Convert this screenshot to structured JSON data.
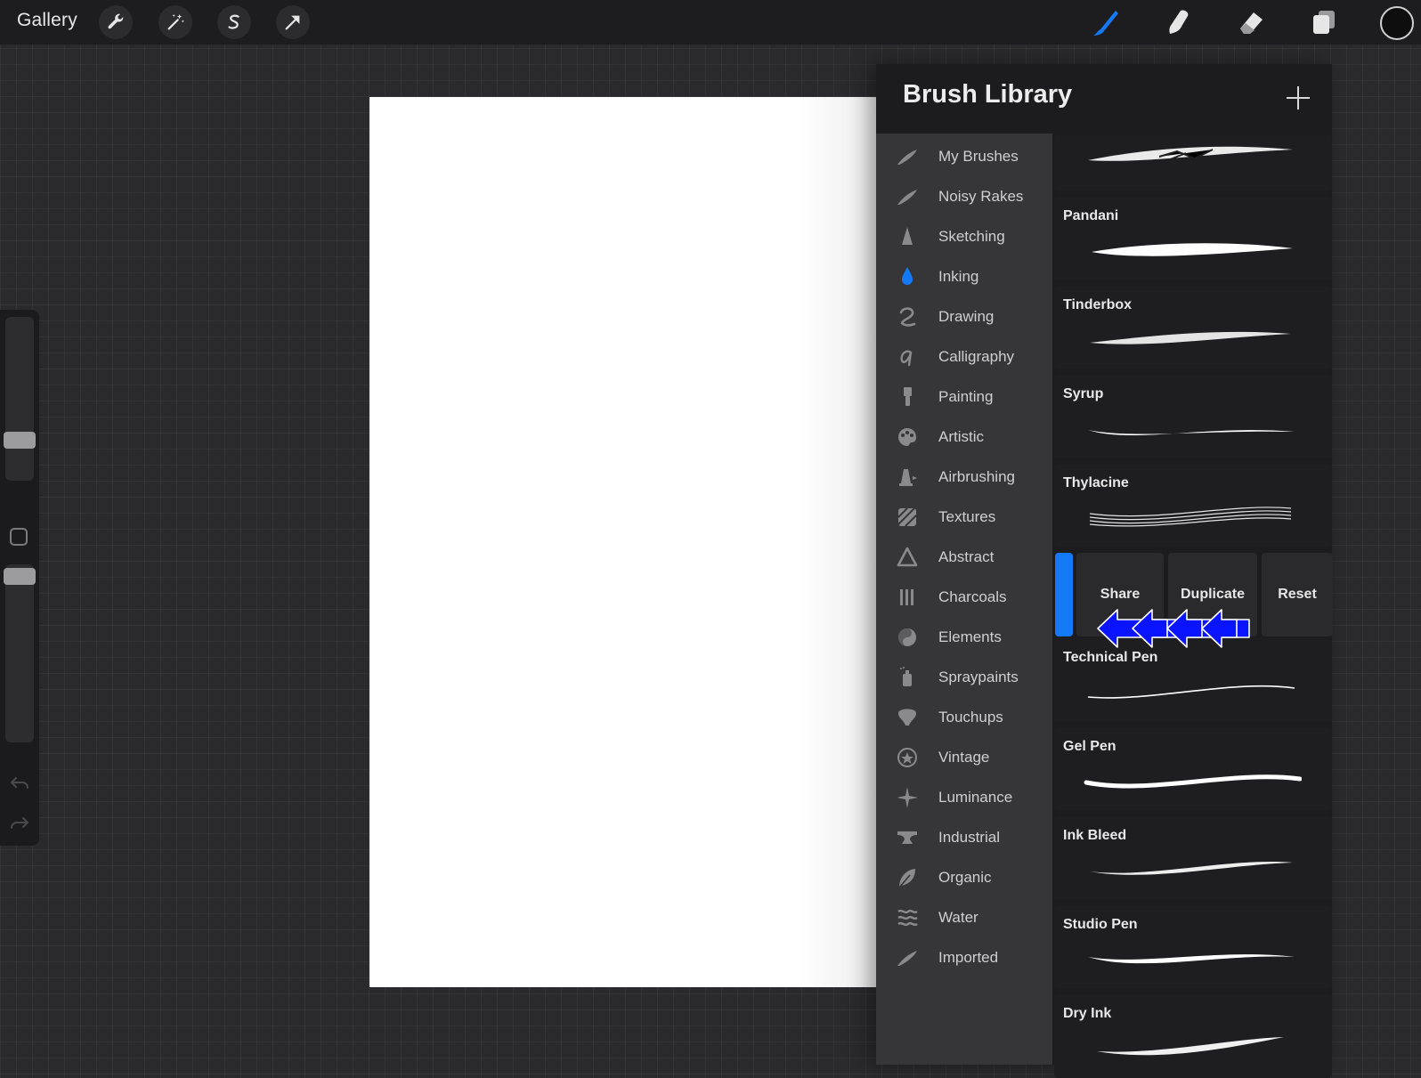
{
  "topbar": {
    "gallery_label": "Gallery",
    "left_tools": [
      "wrench-icon",
      "magic-wand-icon",
      "selection-s-icon",
      "move-arrow-icon"
    ],
    "right_tools": [
      "brush-icon",
      "smudge-icon",
      "eraser-icon",
      "layers-icon"
    ],
    "active_tool": "brush-icon",
    "active_color": "#1479f5",
    "current_color": "#0e0e0e"
  },
  "sidebar": {
    "brush_size_level": 0.22,
    "opacity_level": 0.98
  },
  "library": {
    "title": "Brush Library",
    "add_icon": "plus-icon",
    "brush_sets": [
      {
        "label": "My Brushes",
        "icon": "feather-icon"
      },
      {
        "label": "Noisy Rakes",
        "icon": "feather-icon"
      },
      {
        "label": "Sketching",
        "icon": "pencil-tip-icon"
      },
      {
        "label": "Inking",
        "icon": "ink-drop-icon",
        "selected": true
      },
      {
        "label": "Drawing",
        "icon": "squiggle-icon"
      },
      {
        "label": "Calligraphy",
        "icon": "calligraphy-a-icon"
      },
      {
        "label": "Painting",
        "icon": "paintbrush-icon"
      },
      {
        "label": "Artistic",
        "icon": "palette-icon"
      },
      {
        "label": "Airbrushing",
        "icon": "airbrush-icon"
      },
      {
        "label": "Textures",
        "icon": "texture-icon"
      },
      {
        "label": "Abstract",
        "icon": "triangle-icon"
      },
      {
        "label": "Charcoals",
        "icon": "charcoal-icon"
      },
      {
        "label": "Elements",
        "icon": "yin-yang-icon"
      },
      {
        "label": "Spraypaints",
        "icon": "spray-can-icon"
      },
      {
        "label": "Touchups",
        "icon": "touchup-icon"
      },
      {
        "label": "Vintage",
        "icon": "star-circle-icon"
      },
      {
        "label": "Luminance",
        "icon": "sparkle-icon"
      },
      {
        "label": "Industrial",
        "icon": "anvil-icon"
      },
      {
        "label": "Organic",
        "icon": "leaf-icon"
      },
      {
        "label": "Water",
        "icon": "waves-icon"
      },
      {
        "label": "Imported",
        "icon": "feather-icon"
      }
    ],
    "brushes": [
      {
        "name": ""
      },
      {
        "name": "Pandani"
      },
      {
        "name": "Tinderbox"
      },
      {
        "name": "Syrup"
      },
      {
        "name": "Thylacine"
      },
      {
        "name": "Technical Pen"
      },
      {
        "name": "Gel Pen"
      },
      {
        "name": "Ink Bleed"
      },
      {
        "name": "Studio Pen"
      },
      {
        "name": "Dry Ink"
      }
    ],
    "swipe_actions": {
      "share": "Share",
      "duplicate": "Duplicate",
      "reset": "Reset"
    },
    "annotation": {
      "icon": "left-arrows-annotation",
      "color": "#0000ff"
    }
  }
}
